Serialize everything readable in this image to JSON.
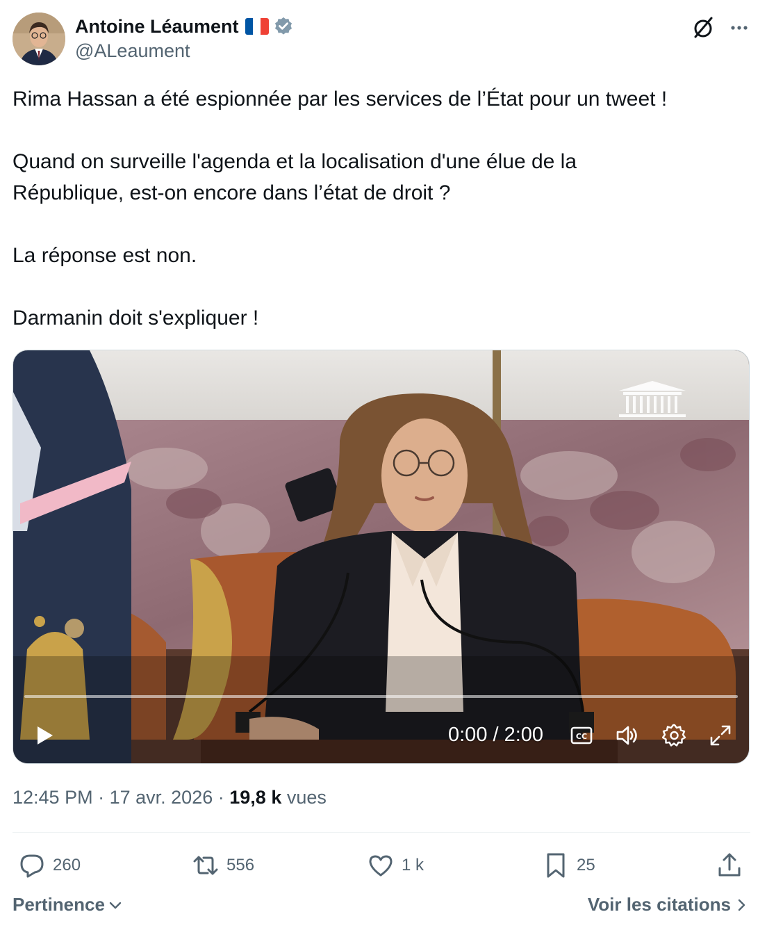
{
  "author": {
    "name": "Antoine Léaument",
    "handle": "@ALeaument",
    "flag_colors": [
      "#0055a4",
      "#ffffff",
      "#ef4135"
    ],
    "verified_color": "#829aab"
  },
  "header": {
    "icons": [
      "grok-icon",
      "more-icon"
    ]
  },
  "tweet": {
    "paragraphs": [
      "Rima Hassan a été espionnée par les services de l’État pour un tweet !",
      "Quand on surveille l'agenda et la localisation d'une élue de la",
      "République, est-on encore dans l’état de droit ?",
      "La réponse est non.",
      "Darmanin doit s'expliquer !"
    ]
  },
  "video": {
    "progress": 0,
    "timecode": "0:00 / 2:00",
    "controls": [
      "play-icon",
      "captions-icon",
      "volume-icon",
      "settings-icon",
      "fullscreen-icon"
    ]
  },
  "meta": {
    "time": "12:45 PM",
    "separator": "·",
    "date": "17 avr. 2026",
    "views_count": "19,8 k",
    "views_label": "vues"
  },
  "actions": {
    "replies": "260",
    "reposts": "556",
    "likes": "1 k",
    "bookmarks": "25",
    "icons": [
      "reply-icon",
      "repost-icon",
      "like-icon",
      "bookmark-icon",
      "share-icon"
    ]
  },
  "footer": {
    "sort_label": "Pertinence",
    "quotes_label": "Voir les citations"
  }
}
